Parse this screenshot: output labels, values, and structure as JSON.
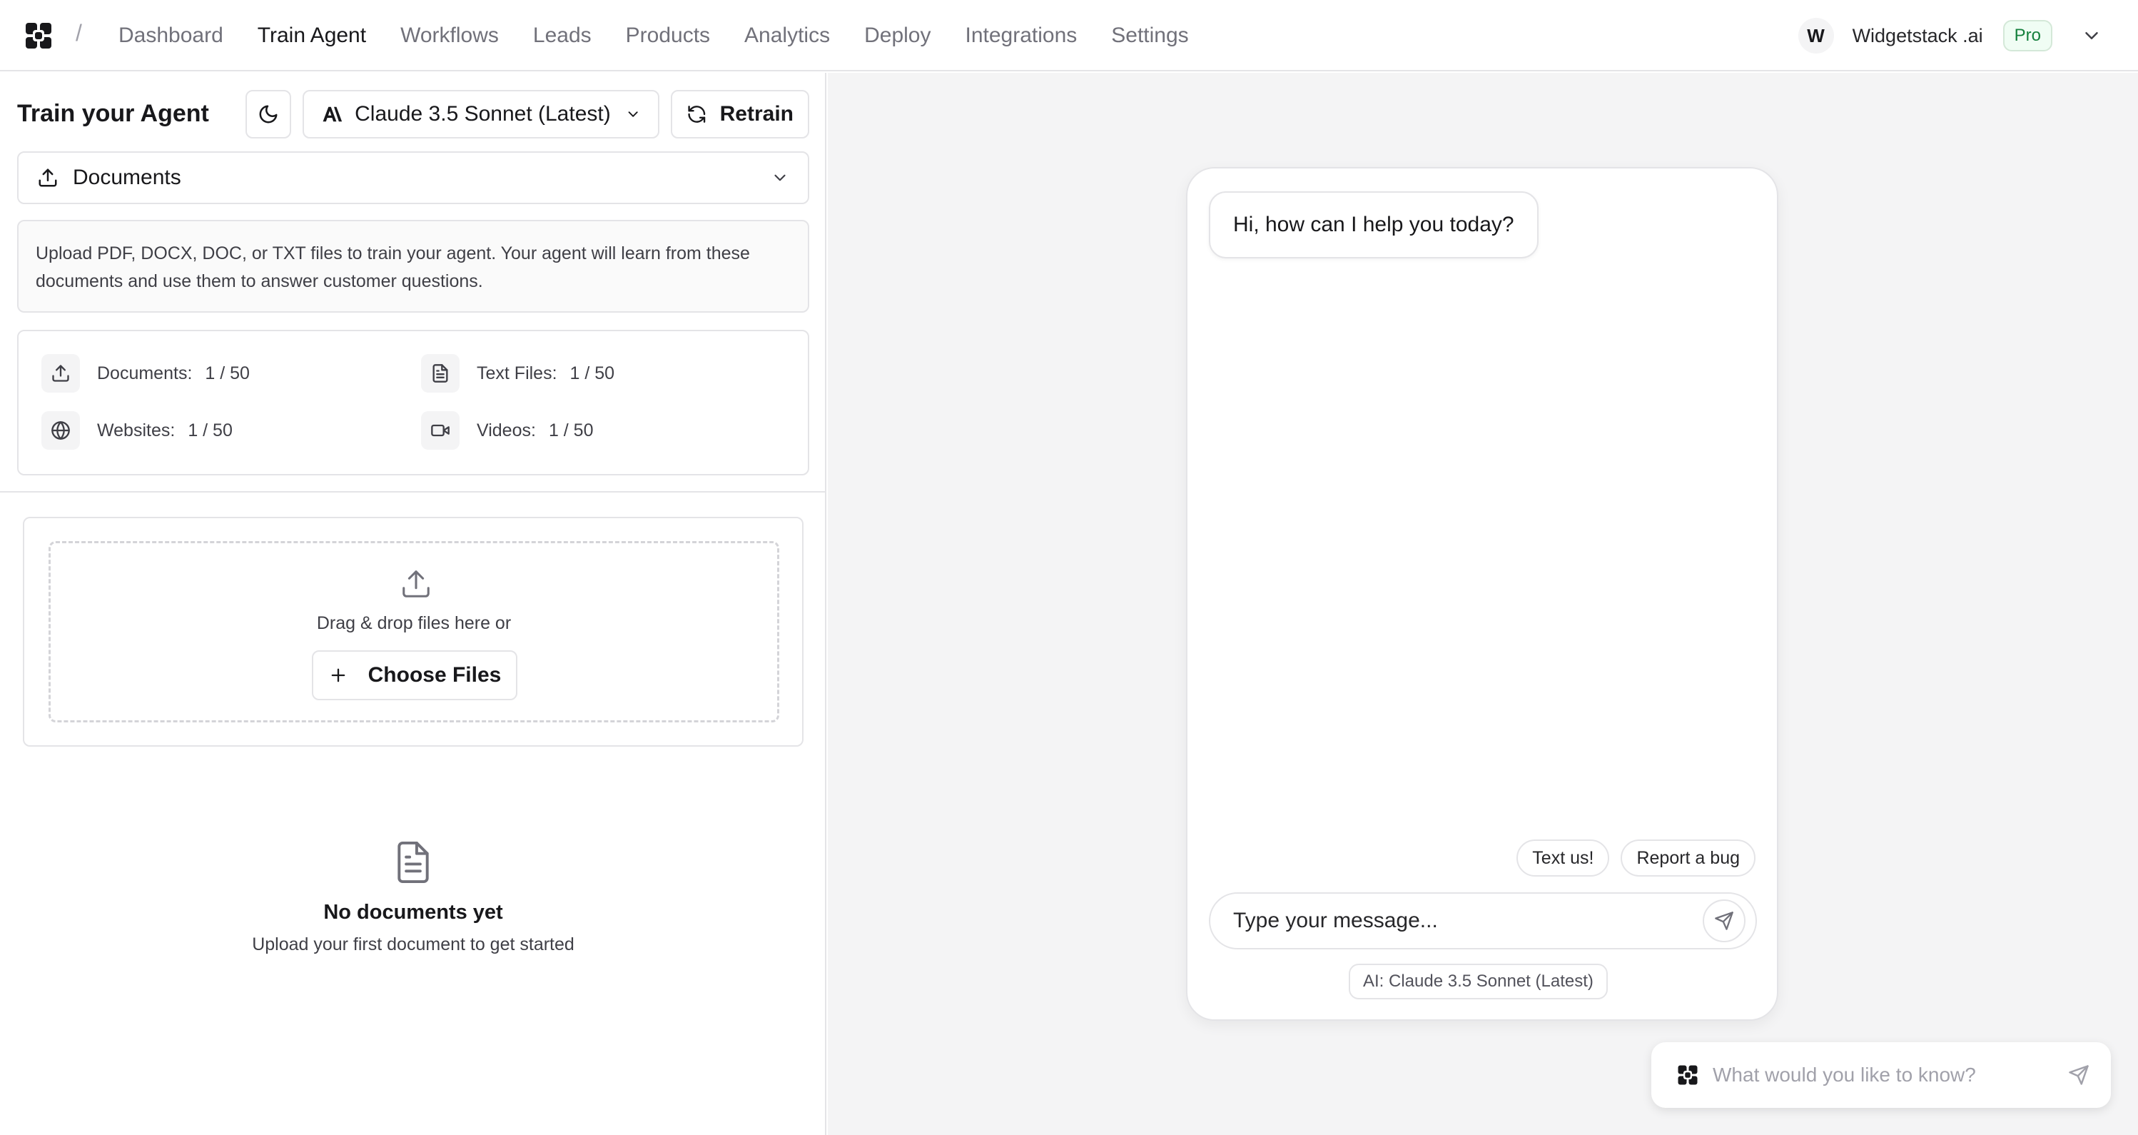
{
  "nav": {
    "separator": "/",
    "items": [
      {
        "label": "Dashboard",
        "active": false
      },
      {
        "label": "Train Agent",
        "active": true
      },
      {
        "label": "Workflows",
        "active": false
      },
      {
        "label": "Leads",
        "active": false
      },
      {
        "label": "Products",
        "active": false
      },
      {
        "label": "Analytics",
        "active": false
      },
      {
        "label": "Deploy",
        "active": false
      },
      {
        "label": "Integrations",
        "active": false
      },
      {
        "label": "Settings",
        "active": false
      }
    ],
    "account": {
      "avatar_initial": "W",
      "org_name": "Widgetstack .ai",
      "plan": "Pro"
    }
  },
  "train": {
    "title": "Train your Agent",
    "model_label": "Claude 3.5 Sonnet (Latest)",
    "retrain_label": "Retrain",
    "section_label": "Documents",
    "info_text": "Upload PDF, DOCX, DOC, or TXT files to train your agent. Your agent will learn from these documents and use them to answer customer questions.",
    "stats": [
      {
        "label": "Documents:",
        "value": "1 / 50",
        "icon": "upload-icon"
      },
      {
        "label": "Text Files:",
        "value": "1 / 50",
        "icon": "file-text-icon"
      },
      {
        "label": "Websites:",
        "value": "1 / 50",
        "icon": "globe-icon"
      },
      {
        "label": "Videos:",
        "value": "1 / 50",
        "icon": "video-icon"
      }
    ],
    "upload": {
      "drop_text": "Drag & drop files here or",
      "choose_label": "Choose Files"
    },
    "empty": {
      "title": "No documents yet",
      "subtitle": "Upload your first document to get started"
    }
  },
  "chat": {
    "greeting": "Hi, how can I help you today?",
    "chips": [
      "Text us!",
      "Report a bug"
    ],
    "input_placeholder": "Type your message...",
    "model_chip": "AI: Claude 3.5 Sonnet (Latest)"
  },
  "ask": {
    "placeholder": "What would you like to know?"
  },
  "colors": {
    "accent_green": "#15803d",
    "border": "#e4e4e7",
    "background_panel": "#f4f4f5"
  }
}
